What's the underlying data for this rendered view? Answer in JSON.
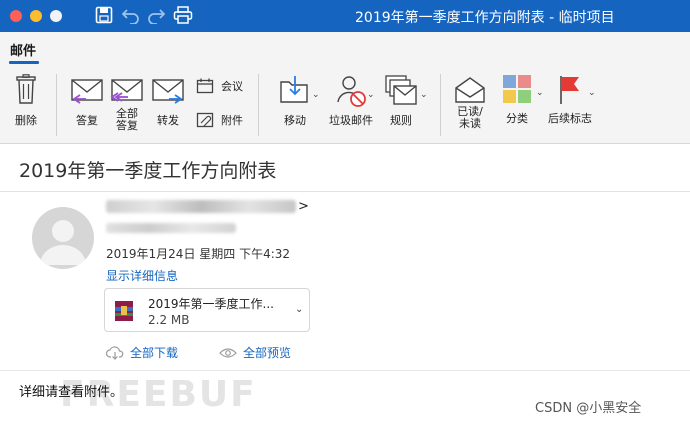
{
  "window": {
    "title": "2019年第一季度工作方向附表 - 临时项目"
  },
  "ribbon": {
    "active_tab": "邮件",
    "buttons": {
      "delete": "删除",
      "reply": "答复",
      "reply_all": "全部\n答复",
      "forward": "转发",
      "meeting": "会议",
      "attachment": "附件",
      "move": "移动",
      "junk": "垃圾邮件",
      "rules": "规则",
      "read_unread": "已读/\n未读",
      "categorize": "分类",
      "follow_up": "后续标志"
    }
  },
  "email": {
    "subject": "2019年第一季度工作方向附表",
    "sender_suffix": ">",
    "date": "2019年1月24日 星期四 下午4:32",
    "show_details": "显示详细信息",
    "attachment": {
      "name": "2019年第一季度工作...",
      "size": "2.2 MB"
    },
    "download_all": "全部下载",
    "preview_all": "全部预览",
    "body": "详细请查看附件。"
  },
  "watermarks": {
    "freebuf": "FREEBUF",
    "csdn": "CSDN @小黑安全"
  },
  "colors": {
    "accent": "#1565c0",
    "titlebar": "#1565c0"
  }
}
